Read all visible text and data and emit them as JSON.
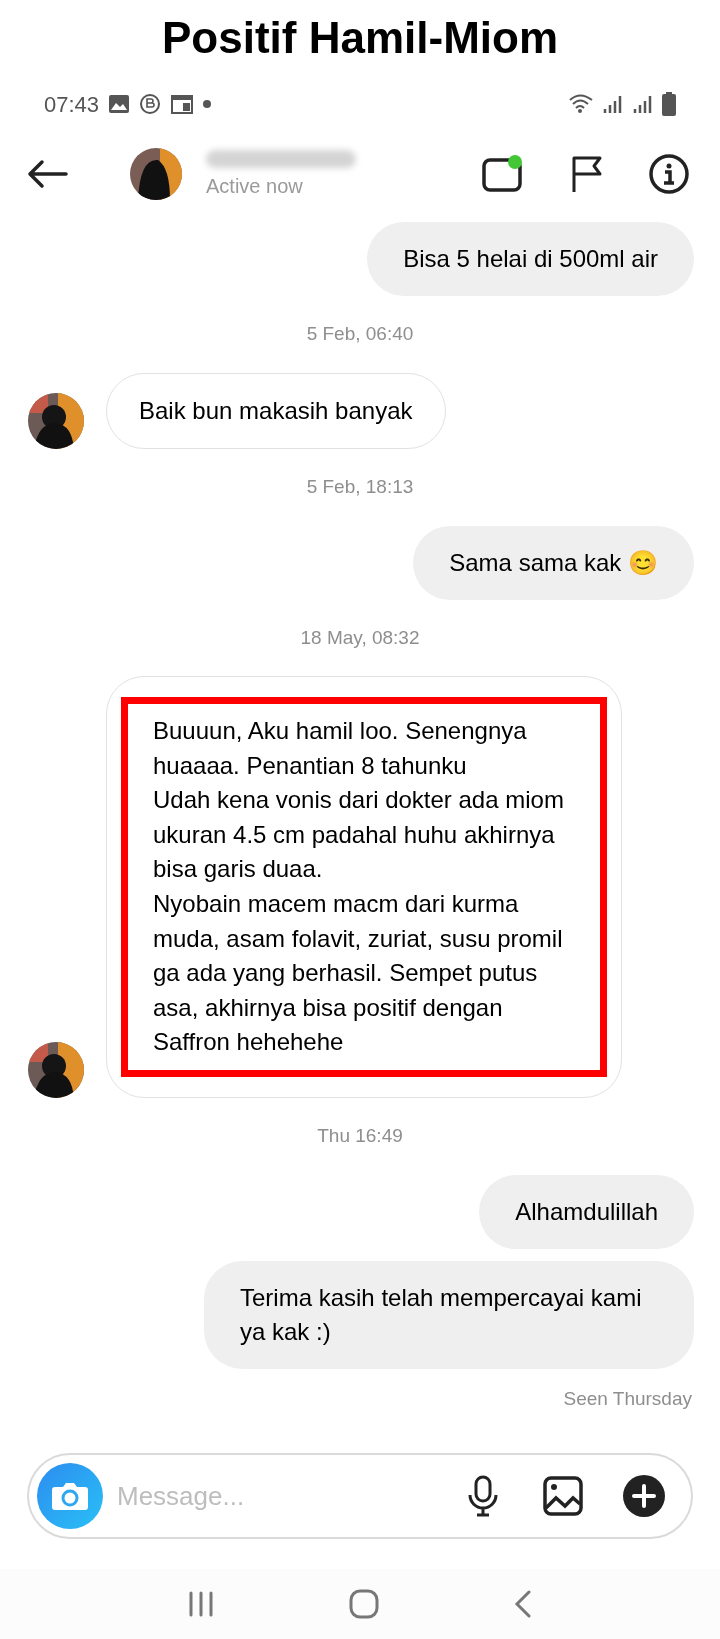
{
  "caption": "Positif Hamil-Miom",
  "status_bar": {
    "time": "07:43"
  },
  "header": {
    "status": "Active now",
    "video_online": true
  },
  "messages": [
    {
      "kind": "sent",
      "text": "Bisa 5 helai di 500ml air"
    },
    {
      "kind": "date",
      "text": "5 Feb, 06:40"
    },
    {
      "kind": "received",
      "text": "Baik bun makasih banyak",
      "highlighted": false
    },
    {
      "kind": "date",
      "text": "5 Feb, 18:13"
    },
    {
      "kind": "sent",
      "text": "Sama sama kak 😊"
    },
    {
      "kind": "date",
      "text": "18 May, 08:32"
    },
    {
      "kind": "received",
      "text": "Buuuun, Aku hamil loo. Senengnya huaaaa. Penantian 8 tahunku\nUdah kena vonis dari dokter ada miom ukuran 4.5 cm padahal huhu akhirnya bisa garis duaa.\nNyobain macem macm dari kurma muda, asam folavit, zuriat, susu promil ga ada yang berhasil. Sempet putus asa, akhirnya bisa positif dengan Saffron hehehehe",
      "highlighted": true
    },
    {
      "kind": "date",
      "text": "Thu 16:49"
    },
    {
      "kind": "sent",
      "text": "Alhamdulillah"
    },
    {
      "kind": "sent",
      "text": "Terima kasih telah mempercayai kami ya kak :)"
    },
    {
      "kind": "seen",
      "text": "Seen Thursday"
    }
  ],
  "composer": {
    "placeholder": "Message..."
  }
}
